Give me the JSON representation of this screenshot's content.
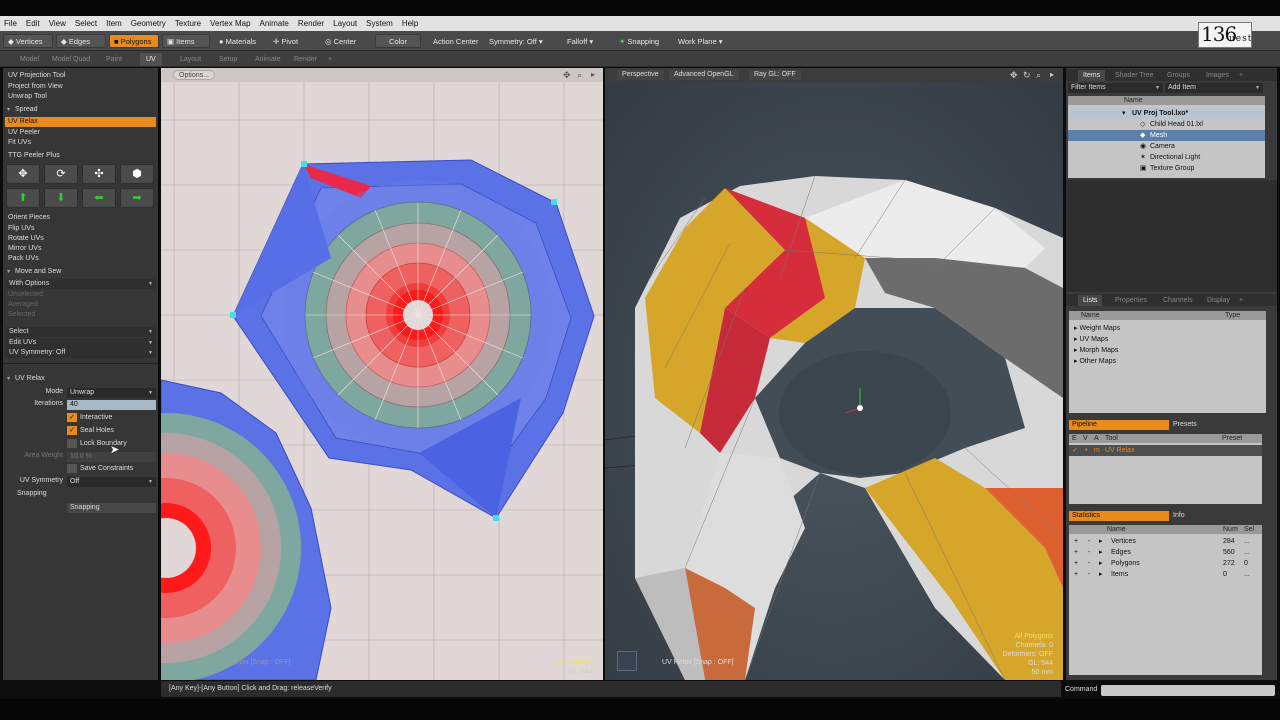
{
  "menu": [
    "File",
    "Edit",
    "View",
    "Select",
    "Item",
    "Geometry",
    "Texture",
    "Vertex Map",
    "Animate",
    "Render",
    "Layout",
    "System",
    "Help"
  ],
  "toolbar": {
    "vertices": "Vertices",
    "edges": "Edges",
    "polygons": "Polygons",
    "items": "Items",
    "materials": "Materials",
    "pivot": "Pivot",
    "center": "Center",
    "color": "Color",
    "action_center": "Action Center",
    "symmetry": "Symmetry: Off",
    "falloff": "Falloff",
    "snapping": "Snapping",
    "work_plane": "Work Plane"
  },
  "logo": {
    "number": "136",
    "suffix": "uest"
  },
  "mode_tabs": [
    "Model",
    "Model Quad",
    "Paint",
    "UV",
    "Layout",
    "Setup",
    "Animate",
    "Render",
    "+"
  ],
  "left": {
    "tools": [
      "UV Projection Tool",
      "Project from View",
      "Unwrap Tool"
    ],
    "spread": "Spread",
    "uv_relax": "UV Relax",
    "tools2": [
      "UV Peeler",
      "Fit UVs"
    ],
    "ttg": "TTG Peeler Plus",
    "tools3": [
      "Orient Pieces",
      "Flip UVs",
      "Rotate UVs",
      "Mirror UVs",
      "Pack UVs"
    ],
    "move_sew": "Move and Sew",
    "with_options": "With Options",
    "dim_items": [
      "Unselected",
      "Averaged",
      "Selected"
    ],
    "dropdowns": [
      "Select",
      "Edit UVs",
      "UV Symmetry: Off"
    ],
    "props_title": "UV Relax",
    "mode_label": "Mode",
    "mode_value": "Unwrap",
    "iterations_label": "Iterations",
    "iterations_value": "40",
    "interactive": "Interactive",
    "seal_holes": "Seal Holes",
    "lock_boundary": "Lock Boundary",
    "area_weight_label": "Area Weight",
    "area_weight_value": "10.0 %",
    "save_constraints": "Save Constraints",
    "uv_symmetry_label": "UV Symmetry",
    "uv_symmetry_value": "Off",
    "snapping_title": "Snapping",
    "snapping_field": "Snapping"
  },
  "uv_view": {
    "options": "Options...",
    "footer": "UV Relax  [Snap : OFF]",
    "footer_right1": "All Polygons",
    "footer_right2": "GL: 544"
  },
  "view3d": {
    "perspective": "Perspective",
    "opengl": "Advanced OpenGL",
    "raygl": "Ray GL: OFF",
    "footer": "UV Relax  [Snap : OFF]",
    "info": [
      "All Polygons",
      "Channels: 0",
      "Deformers: OFF",
      "GL: 544",
      "50 mm"
    ]
  },
  "items_panel": {
    "tabs": [
      "Items",
      "Shader Tree",
      "Groups",
      "Images",
      "+"
    ],
    "filter": "Filter Items",
    "add": "Add Item",
    "col_name": "Name",
    "rows": [
      "UV Proj Tool.lxo*",
      "Child Head 01.lxl",
      "Mesh",
      "Camera",
      "Directional Light",
      "Texture Group"
    ]
  },
  "lists_panel": {
    "tabs": [
      "Lists",
      "Properties",
      "Channels",
      "Display",
      "+"
    ],
    "col_name": "Name",
    "col_type": "Type",
    "rows": [
      "Weight Maps",
      "UV Maps",
      "Morph Maps",
      "Other Maps"
    ]
  },
  "pipeline": {
    "tab": "Pipeline",
    "presets_tab": "Presets",
    "cols": [
      "E",
      "V",
      "A",
      "Tool",
      "Preset"
    ],
    "row": "UV Relax"
  },
  "statistics": {
    "tab": "Statistics",
    "info_tab": "Info",
    "cols": [
      "Name",
      "Num",
      "Sel"
    ],
    "rows": [
      {
        "name": "Vertices",
        "num": "284",
        "sel": "..."
      },
      {
        "name": "Edges",
        "num": "560",
        "sel": "..."
      },
      {
        "name": "Polygons",
        "num": "272",
        "sel": "0"
      },
      {
        "name": "Items",
        "num": "0",
        "sel": "..."
      }
    ]
  },
  "status": "[Any Key]-[Any Button] Click and Drag:  releaseVerify",
  "command_label": "Command",
  "colors": {
    "accent": "#e88a1c",
    "uv_bg": "#e2d7d7",
    "viewport_bg": "#3f4a52"
  }
}
